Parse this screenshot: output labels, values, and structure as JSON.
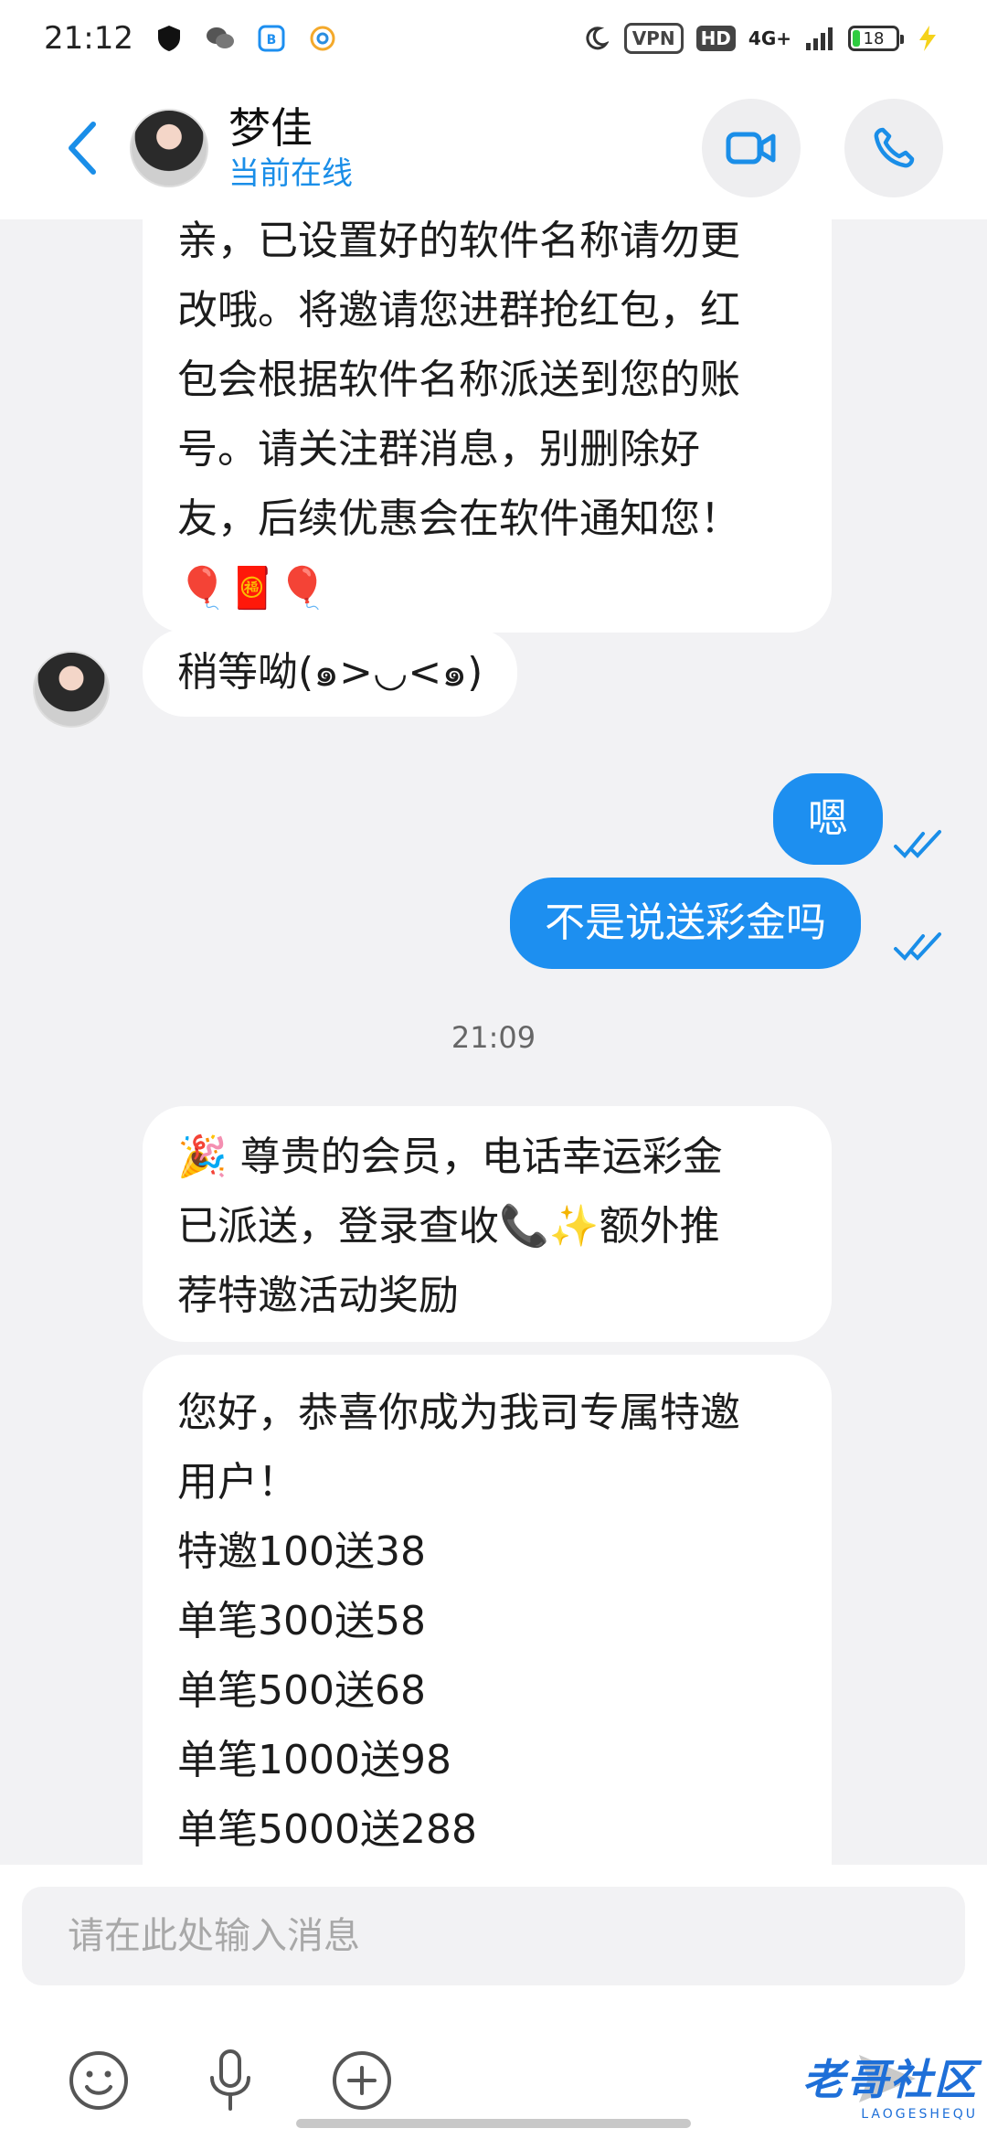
{
  "status_bar": {
    "time": "21:12",
    "vpn": "VPN",
    "hd": "HD",
    "network": "4G+",
    "battery": "18"
  },
  "header": {
    "contact_name": "梦佳",
    "contact_status": "当前在线",
    "icons": [
      "back-arrow-icon",
      "video-call-icon",
      "phone-icon"
    ]
  },
  "messages": [
    {
      "direction": "in",
      "text": "亲，已设置好的软件名称请勿更\n改哦。将邀请您进群抢红包，红\n包会根据软件名称派送到您的账\n号。请关注群消息，别删除好\n友，后续优惠会在软件通知您！\n🎈🧧🎈"
    },
    {
      "direction": "in",
      "text": "稍等呦(๑>◡<๑)"
    },
    {
      "direction": "out",
      "text": "嗯",
      "read": true
    },
    {
      "direction": "out",
      "text": "不是说送彩金吗",
      "read": true
    },
    {
      "type": "time",
      "text": "21:09"
    },
    {
      "direction": "in",
      "text": "🎉 尊贵的会员，电话幸运彩金\n已派送，登录查收📞✨额外推\n荐特邀活动奖励"
    },
    {
      "direction": "in",
      "text": "您好，恭喜你成为我司专属特邀\n用户！\n特邀100送38\n单笔300送58\n单笔500送68\n单笔1000送98\n单笔5000送288"
    }
  ],
  "input": {
    "placeholder": "请在此处输入消息"
  },
  "toolbar": {
    "icons": [
      "emoji-icon",
      "microphone-icon",
      "add-icon",
      "send-icon"
    ]
  },
  "watermark": {
    "main": "老哥社区",
    "sub": "LAOGESHEQU"
  },
  "colors": {
    "accent": "#1d8ff0",
    "status_online": "#1a8ee8",
    "background": "#f2f2f4"
  }
}
